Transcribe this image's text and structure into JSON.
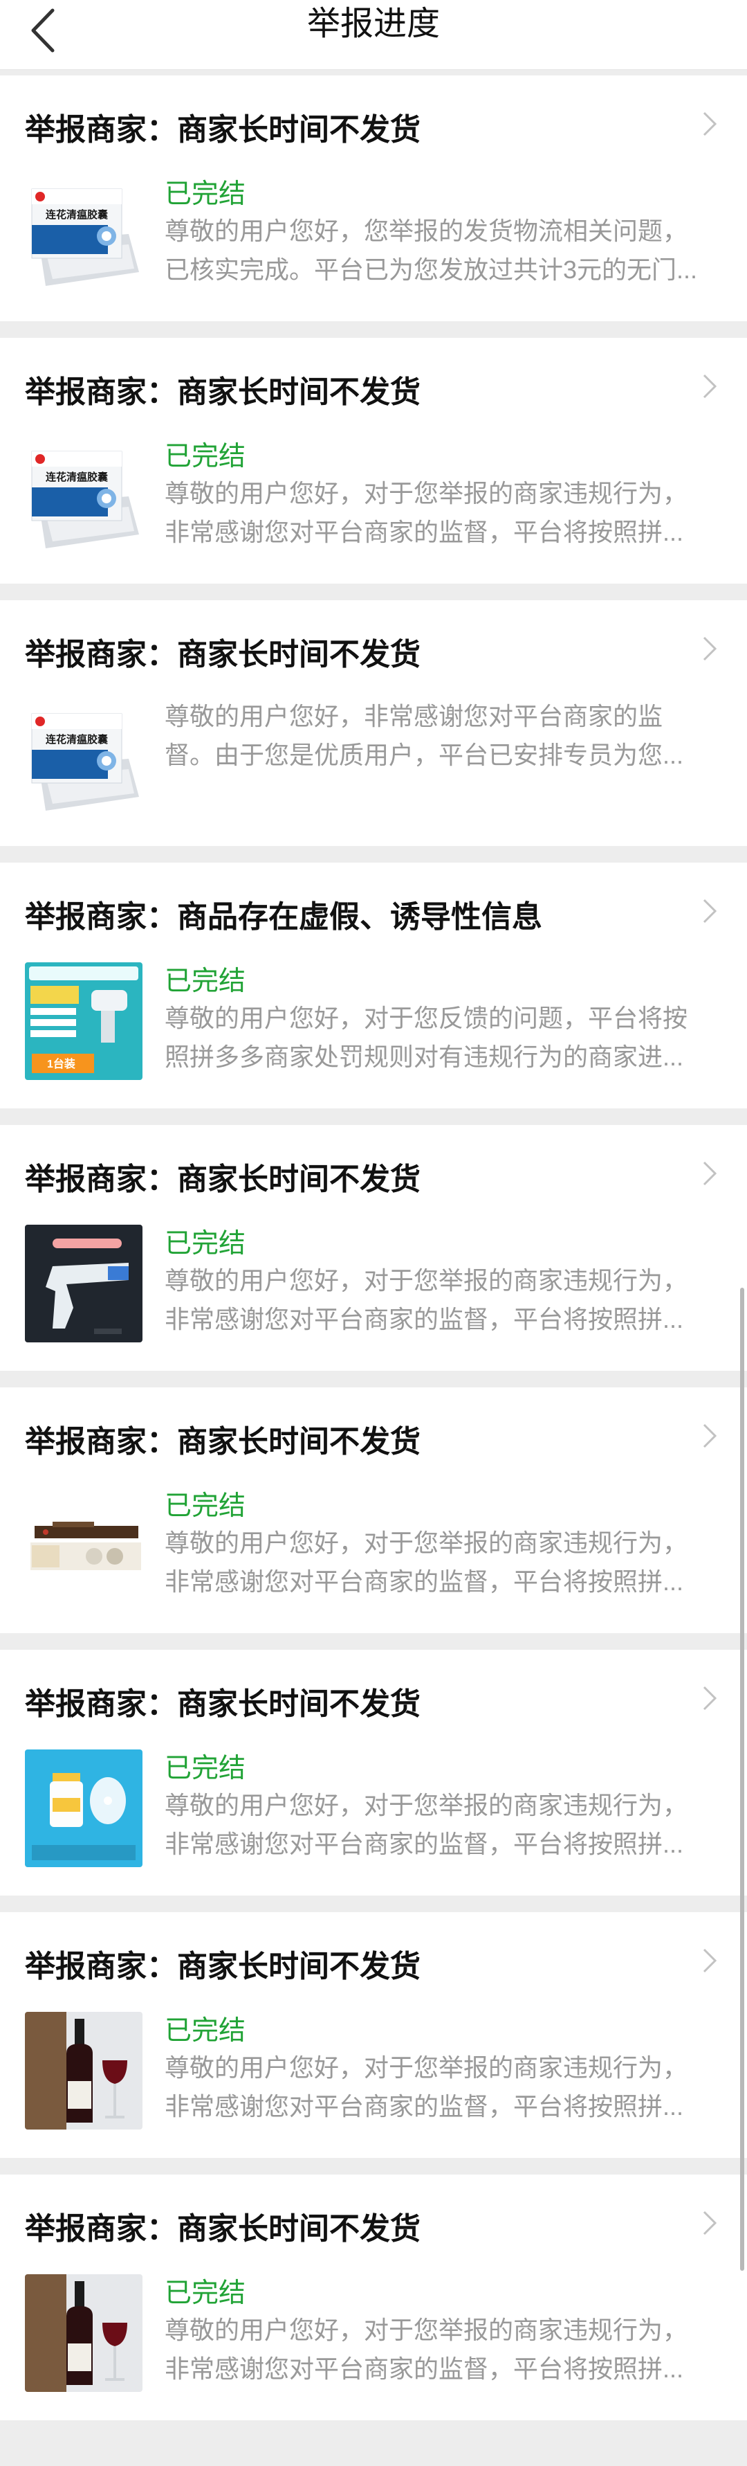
{
  "navbar": {
    "title": "举报进度",
    "back_icon": "back-arrow-icon"
  },
  "reports": [
    {
      "title": "举报商家：商家长时间不发货",
      "status": "已完结",
      "desc_line1": "尊敬的用户您好，您举报的发货物流相关问题，",
      "desc_line2": "已核实完成。平台已为您发放过共计3元的无门...",
      "thumb": "medicine-box",
      "thumb_label": "连花清瘟胶囊"
    },
    {
      "title": "举报商家：商家长时间不发货",
      "status": "已完结",
      "desc_line1": "尊敬的用户您好，对于您举报的商家违规行为，",
      "desc_line2": "非常感谢您对平台商家的监督，平台将按照拼...",
      "thumb": "medicine-box",
      "thumb_label": "连花清瘟胶囊"
    },
    {
      "title": "举报商家：商家长时间不发货",
      "status": "",
      "desc_line1": "尊敬的用户您好，非常感谢您对平台商家的监",
      "desc_line2": "督。由于您是优质用户，平台已安排专员为您...",
      "thumb": "medicine-box",
      "thumb_label": "连花清瘟胶囊"
    },
    {
      "title": "举报商家：商品存在虚假、诱导性信息",
      "status": "已完结",
      "desc_line1": "尊敬的用户您好，对于您反馈的问题，平台将按",
      "desc_line2": "照拼多多商家处罚规则对有违规行为的商家进...",
      "thumb": "spray-gun-ad",
      "thumb_label": "1台装"
    },
    {
      "title": "举报商家：商家长时间不发货",
      "status": "已完结",
      "desc_line1": "尊敬的用户您好，对于您举报的商家违规行为，",
      "desc_line2": "非常感谢您对平台商家的监督，平台将按照拼...",
      "thumb": "spray-gun-dark",
      "thumb_label": ""
    },
    {
      "title": "举报商家：商家长时间不发货",
      "status": "已完结",
      "desc_line1": "尊敬的用户您好，对于您举报的商家违规行为，",
      "desc_line2": "非常感谢您对平台商家的监督，平台将按照拼...",
      "thumb": "tea-box",
      "thumb_label": ""
    },
    {
      "title": "举报商家：商家长时间不发货",
      "status": "已完结",
      "desc_line1": "尊敬的用户您好，对于您举报的商家违规行为，",
      "desc_line2": "非常感谢您对平台商家的监督，平台将按照拼...",
      "thumb": "blue-bottle",
      "thumb_label": ""
    },
    {
      "title": "举报商家：商家长时间不发货",
      "status": "已完结",
      "desc_line1": "尊敬的用户您好，对于您举报的商家违规行为，",
      "desc_line2": "非常感谢您对平台商家的监督，平台将按照拼...",
      "thumb": "wine-bottle",
      "thumb_label": ""
    },
    {
      "title": "举报商家：商家长时间不发货",
      "status": "已完结",
      "desc_line1": "尊敬的用户您好，对于您举报的商家违规行为，",
      "desc_line2": "非常感谢您对平台商家的监督，平台将按照拼...",
      "thumb": "wine-bottle",
      "thumb_label": ""
    }
  ],
  "colors": {
    "status_green": "#21a336",
    "desc_gray": "#999999",
    "page_bg": "#ededed"
  }
}
